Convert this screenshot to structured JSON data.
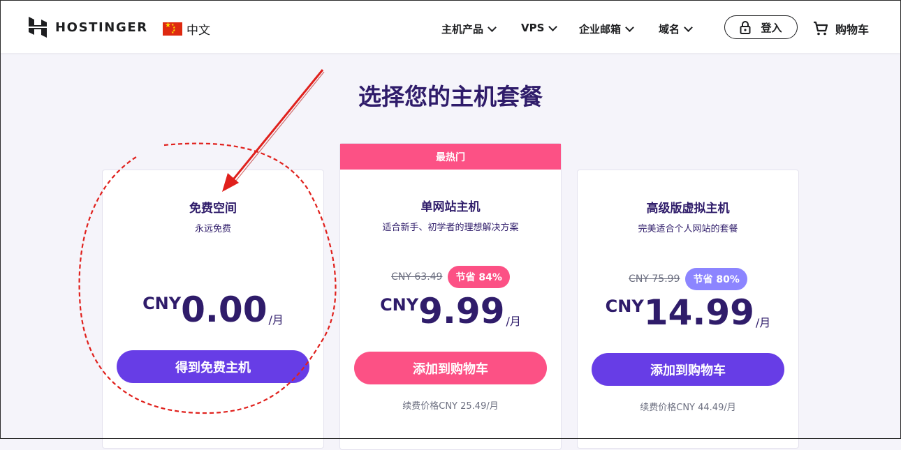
{
  "header": {
    "logo_text": "HOSTINGER",
    "language": "中文",
    "nav": [
      "主机产品",
      "VPS",
      "企业邮箱",
      "域名"
    ],
    "login": "登入",
    "cart": "购物车"
  },
  "page_title": "选择您的主机套餐",
  "plans": [
    {
      "name": "免费空间",
      "subtitle": "永远免费",
      "currency": "CNY",
      "price": "0.00",
      "per": "/月",
      "cta": "得到免费主机"
    },
    {
      "ribbon": "最热门",
      "name": "单网站主机",
      "subtitle": "适合新手、初学者的理想解决方案",
      "old_price": "CNY 63.49",
      "save": "节省 84%",
      "currency": "CNY",
      "price": "9.99",
      "per": "/月",
      "cta": "添加到购物车",
      "renewal": "续费价格CNY 25.49/月"
    },
    {
      "name": "高级版虚拟主机",
      "subtitle": "完美适合个人网站的套餐",
      "old_price": "CNY 75.99",
      "save": "节省 80%",
      "currency": "CNY",
      "price": "14.99",
      "per": "/月",
      "cta": "添加到购物车",
      "renewal": "续费价格CNY 44.49/月"
    }
  ],
  "colors": {
    "primary": "#673de6",
    "pink": "#fc5185",
    "badge_purple": "#8c85ff",
    "text_dark": "#2f1c6a",
    "annotation_red": "#e0201c"
  }
}
